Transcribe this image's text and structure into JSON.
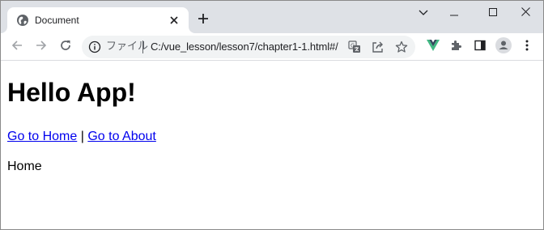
{
  "tab": {
    "title": "Document",
    "favicon": "globe-icon",
    "close_icon": "close-icon",
    "new_tab_icon": "plus-icon"
  },
  "window_controls": {
    "tab_search_icon": "chevron-down-icon",
    "minimize_icon": "minimize-icon",
    "maximize_icon": "maximize-icon",
    "close_icon": "close-icon"
  },
  "toolbar": {
    "back_icon": "arrow-left-icon",
    "forward_icon": "arrow-right-icon",
    "reload_icon": "reload-icon",
    "omnibox": {
      "info_icon": "info-icon",
      "scheme_label": "ファイル",
      "url": "C:/vue_lesson/lesson7/chapter1-1.html#/",
      "translate_icon": "translate-icon",
      "share_icon": "share-icon",
      "bookmark_icon": "star-icon"
    },
    "vue_devtools_icon": "vue-icon",
    "extensions_icon": "puzzle-icon",
    "side_panel_icon": "side-panel-icon",
    "profile_icon": "profile-icon",
    "menu_icon": "kebab-menu-icon"
  },
  "page": {
    "heading": "Hello App!",
    "links": [
      {
        "label": "Go to Home"
      },
      {
        "label": "Go to About"
      }
    ],
    "separator": "|",
    "router_view_text": "Home"
  },
  "colors": {
    "tabstrip_bg": "#dee1e6",
    "omnibox_bg": "#f1f3f4",
    "link": "#0000ee",
    "vue_green": "#41b883",
    "vue_dark": "#35495e"
  }
}
